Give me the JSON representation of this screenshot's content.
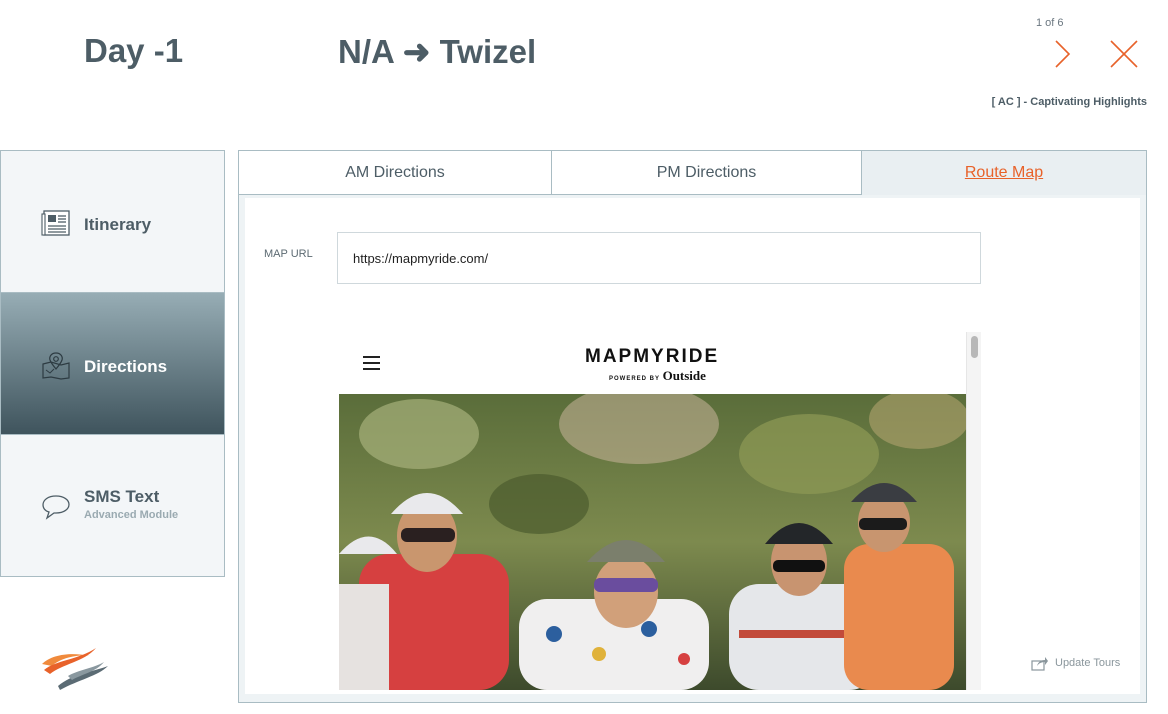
{
  "header": {
    "day": "Day -1",
    "route": "N/A ➜ Twizel",
    "page_count": "1 of 6",
    "tour_label": "[ AC ] - Captivating Highlights"
  },
  "sidebar": {
    "items": [
      {
        "label": "Itinerary",
        "icon": "itinerary-icon",
        "active": false
      },
      {
        "label": "Directions",
        "icon": "map-pin-icon",
        "active": true
      },
      {
        "label": "SMS Text",
        "sub": "Advanced Module",
        "icon": "chat-bubble-icon",
        "active": false
      }
    ]
  },
  "tabs": [
    {
      "label": "AM Directions"
    },
    {
      "label": "PM Directions"
    },
    {
      "label": "Route Map",
      "active": true
    }
  ],
  "map": {
    "url_label": "MAP URL",
    "url_value": "https://mapmyride.com/"
  },
  "embed": {
    "brand": "MAPMYRIDE",
    "brand_powered": "POWERED BY",
    "brand_partner": "Outside"
  },
  "actions": {
    "update_tours": "Update Tours"
  },
  "colors": {
    "accent": "#e8622a",
    "title": "#4d5d66",
    "active_gradient_top": "#97adb5",
    "active_gradient_bottom": "#3f545d",
    "border": "#a9bcc3"
  }
}
